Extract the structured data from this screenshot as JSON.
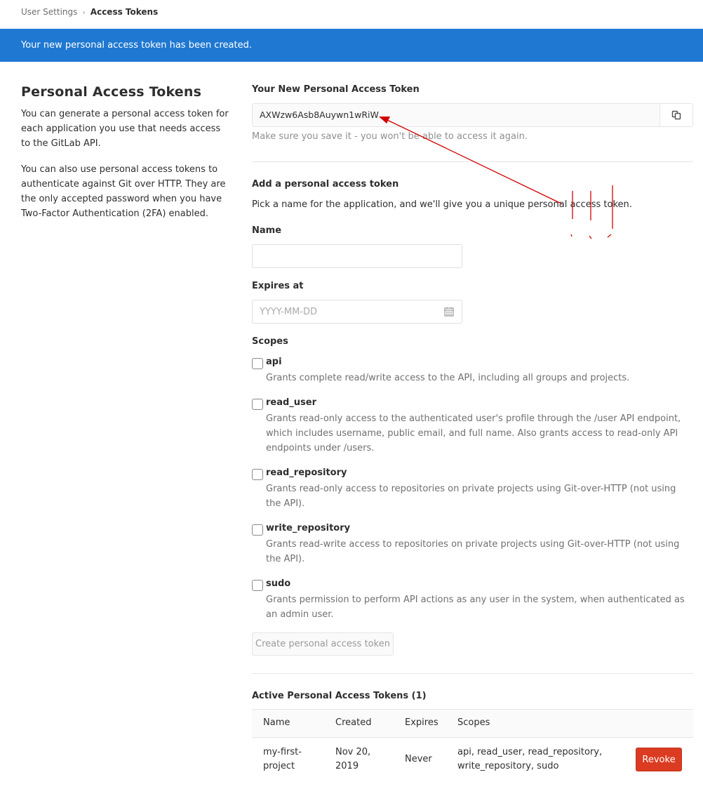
{
  "breadcrumb": {
    "parent": "User Settings",
    "current": "Access Tokens"
  },
  "flash": {
    "message": "Your new personal access token has been created."
  },
  "intro": {
    "title": "Personal Access Tokens",
    "paragraph1": "You can generate a personal access token for each application you use that needs access to the GitLab API.",
    "paragraph2": "You can also use personal access tokens to authenticate against Git over HTTP. They are the only accepted password when you have Two-Factor Authentication (2FA) enabled."
  },
  "new_token": {
    "label": "Your New Personal Access Token",
    "value": "AXWzw6Asb8Auywn1wRiW",
    "hint": "Make sure you save it - you won't be able to access it again.",
    "copy_icon": "clipboard-icon"
  },
  "form": {
    "heading": "Add a personal access token",
    "description": "Pick a name for the application, and we'll give you a unique personal access token.",
    "name_label": "Name",
    "name_value": "",
    "expires_label": "Expires at",
    "expires_placeholder": "YYYY-MM-DD",
    "scopes_label": "Scopes",
    "scopes": [
      {
        "name": "api",
        "description": "Grants complete read/write access to the API, including all groups and projects."
      },
      {
        "name": "read_user",
        "description": "Grants read-only access to the authenticated user's profile through the /user API endpoint, which includes username, public email, and full name. Also grants access to read-only API endpoints under /users."
      },
      {
        "name": "read_repository",
        "description": "Grants read-only access to repositories on private projects using Git-over-HTTP (not using the API)."
      },
      {
        "name": "write_repository",
        "description": "Grants read-write access to repositories on private projects using Git-over-HTTP (not using the API)."
      },
      {
        "name": "sudo",
        "description": "Grants permission to perform API actions as any user in the system, when authenticated as an admin user."
      }
    ],
    "submit_label": "Create personal access token"
  },
  "active": {
    "heading": "Active Personal Access Tokens (1)",
    "columns": [
      "Name",
      "Created",
      "Expires",
      "Scopes"
    ],
    "rows": [
      {
        "name": "my-first-project",
        "created": "Nov 20, 2019",
        "expires": "Never",
        "scopes": "api, read_user, read_repository, write_repository, sudo",
        "action": "Revoke"
      }
    ]
  },
  "colors": {
    "flash_bg": "#1f78d1",
    "revoke_bg": "#db3b21",
    "annotation": "#d40000"
  }
}
